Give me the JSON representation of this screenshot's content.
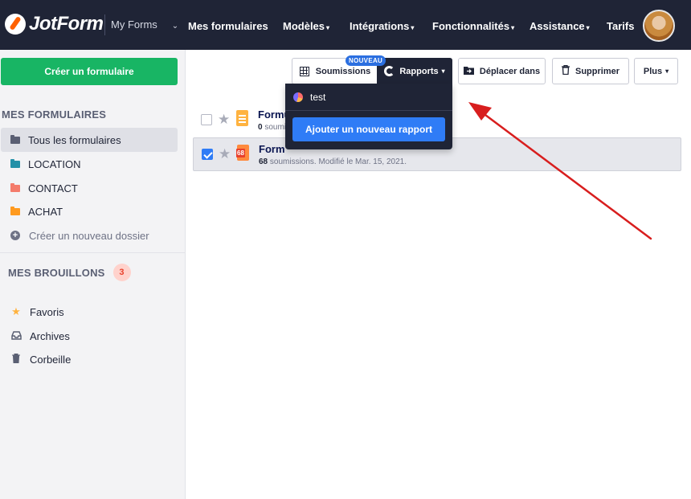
{
  "header": {
    "logo_text": "JotForm",
    "myforms_label": "My Forms",
    "nav": [
      {
        "label": "Mes formulaires",
        "caret": ""
      },
      {
        "label": "Modèles",
        "caret": "▾"
      },
      {
        "label": "Intégrations",
        "caret": "▾"
      },
      {
        "label": "Fonctionnalités",
        "caret": "▾"
      },
      {
        "label": "Assistance",
        "caret": "▾"
      },
      {
        "label": "Tarifs",
        "caret": ""
      }
    ]
  },
  "sidebar": {
    "create_button": "Créer un formulaire",
    "forms_section": "MES FORMULAIRES",
    "folders": [
      {
        "label": "Tous les formulaires",
        "color": "#5a5f73"
      },
      {
        "label": "LOCATION",
        "color": "#2390a8"
      },
      {
        "label": "CONTACT",
        "color": "#f47b6b"
      },
      {
        "label": "ACHAT",
        "color": "#ff9a1f"
      }
    ],
    "new_folder": "Créer un nouveau dossier",
    "drafts_section": "MES BROUILLONS",
    "drafts_count": "3",
    "extras": [
      {
        "label": "Favoris",
        "icon": "star-icon"
      },
      {
        "label": "Archives",
        "icon": "inbox-icon"
      },
      {
        "label": "Corbeille",
        "icon": "trash-icon"
      }
    ]
  },
  "toolbar": {
    "submissions": "Soumissions",
    "new_badge": "NOUVEAU",
    "reports": "Rapports",
    "move": "Déplacer dans",
    "delete": "Supprimer",
    "more": "Plus"
  },
  "reports_dropdown": {
    "item": "test",
    "add_button": "Ajouter un nouveau rapport"
  },
  "forms": [
    {
      "title": "Formu",
      "count": "0",
      "rest": " soumi",
      "selected": false
    },
    {
      "title": "Form",
      "count": "68",
      "rest": " soumissions. Modifié le Mar. 15, 2021.",
      "badge": "68",
      "selected": true
    }
  ],
  "colors": {
    "topbar": "#1f2436",
    "create_green": "#18b564",
    "primary_blue": "#2f7cf6",
    "annotation_red": "#d81e1e"
  }
}
